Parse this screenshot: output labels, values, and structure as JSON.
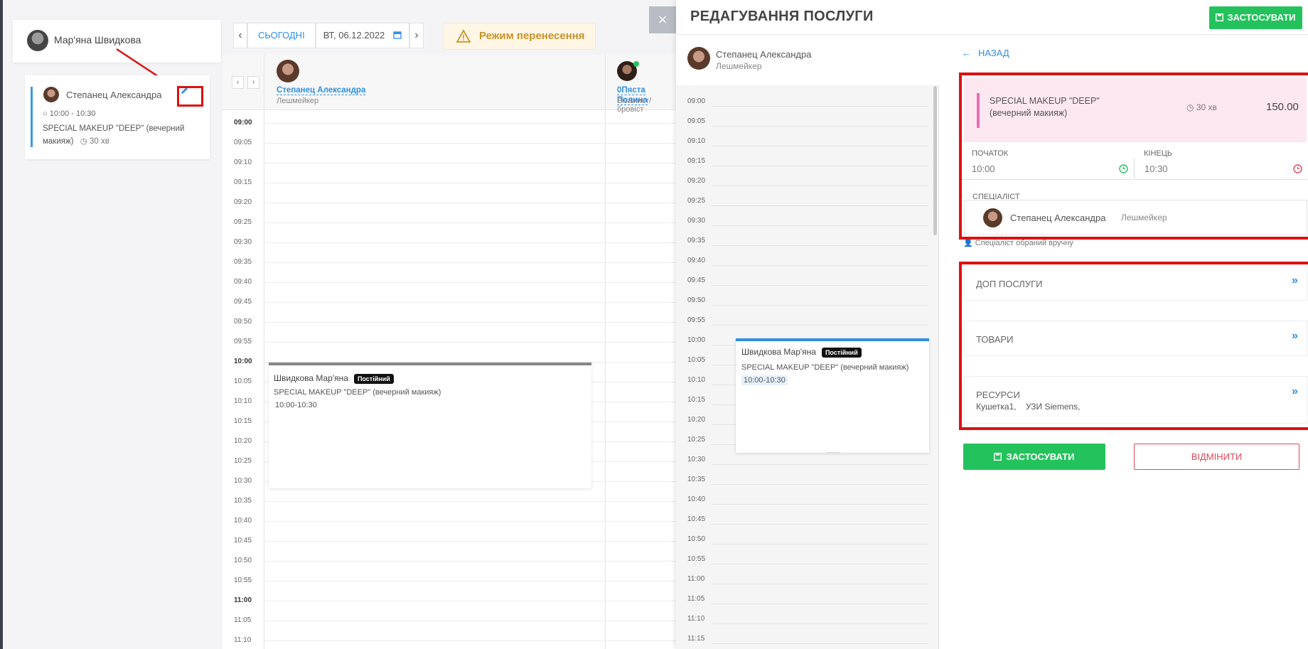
{
  "client": {
    "name": "Мар'яна Швидкова"
  },
  "booking": {
    "specialist": "Степанец Александра",
    "time": "10:00 - 10:30",
    "service": "SPECIAL MAKEUP \"DEEP\" (вечерний макияж)",
    "duration": "30 хв"
  },
  "toolbar": {
    "prev": "‹",
    "today": "СЬОГОДНІ",
    "date": "ВТ, 06.12.2022",
    "next": "›",
    "mode": "Режим перенесення"
  },
  "calendar": {
    "nav_prev": "‹",
    "nav_next": "›",
    "specialists": [
      {
        "name": "Степанец Александра",
        "role": "Лешмейкер"
      },
      {
        "name": "0Пяста Полина",
        "role": "Візажист/бровіст"
      }
    ],
    "times": [
      "09:00",
      "09:05",
      "09:10",
      "09:15",
      "09:20",
      "09:25",
      "09:30",
      "09:35",
      "09:40",
      "09:45",
      "09:50",
      "09:55",
      "10:00",
      "10:05",
      "10:10",
      "10:15",
      "10:20",
      "10:25",
      "10:30",
      "10:35",
      "10:40",
      "10:45",
      "10:50",
      "10:55",
      "11:00",
      "11:05",
      "11:10"
    ],
    "event": {
      "client": "Швидкова Мар'яна",
      "badge": "Постійний",
      "service": "SPECIAL MAKEUP \"DEEP\" (вечерний макияж)",
      "time": "10:00-10:30"
    }
  },
  "panel": {
    "close": "×",
    "title": "РЕДАГУВАННЯ ПОСЛУГИ",
    "apply_top": "ЗАСТОСУВАТИ",
    "specialist": {
      "name": "Степанец Александра",
      "role": "Лешмейкер"
    },
    "times": [
      "09:00",
      "09:05",
      "09:10",
      "09:15",
      "09:20",
      "09:25",
      "09:30",
      "09:35",
      "09:40",
      "09:45",
      "09:50",
      "09:55",
      "10:00",
      "10:05",
      "10:10",
      "10:15",
      "10:20",
      "10:25",
      "10:30",
      "10:35",
      "10:40",
      "10:45",
      "10:50",
      "10:55",
      "11:00",
      "11:05",
      "11:10",
      "11:15"
    ],
    "event": {
      "client": "Швидкова Мар'яна",
      "badge": "Постійний",
      "service": "SPECIAL MAKEUP \"DEEP\" (вечерний макияж)",
      "time": "10:00-10:30"
    },
    "back": "НАЗАД",
    "service": {
      "name": "SPECIAL MAKEUP \"DEEP\" (вечерний макияж)",
      "duration": "30 хв",
      "price": "150.00"
    },
    "start": {
      "label": "ПОЧАТОК",
      "value": "10:00"
    },
    "end": {
      "label": "КІНЕЦЬ",
      "value": "10:30"
    },
    "specialist_label": "СПЕЦІАЛІСТ",
    "specialist_name": "Степанец Александра",
    "specialist_role": "Лешмейкер",
    "note": "Спеціаліст обраний вручну",
    "extras": "ДОП ПОСЛУГИ",
    "products": "ТОВАРИ",
    "resources": "РЕСУРСИ",
    "resources_value": "Кушетка1,    УЗИ Siemens,",
    "apply": "ЗАСТОСУВАТИ",
    "cancel": "ВІДМІНИТИ",
    "chevron": "»"
  },
  "colors": {
    "accent": "#2f8fe0",
    "success": "#24c25c",
    "danger": "#e04a5a",
    "highlight": "#dd1111"
  }
}
